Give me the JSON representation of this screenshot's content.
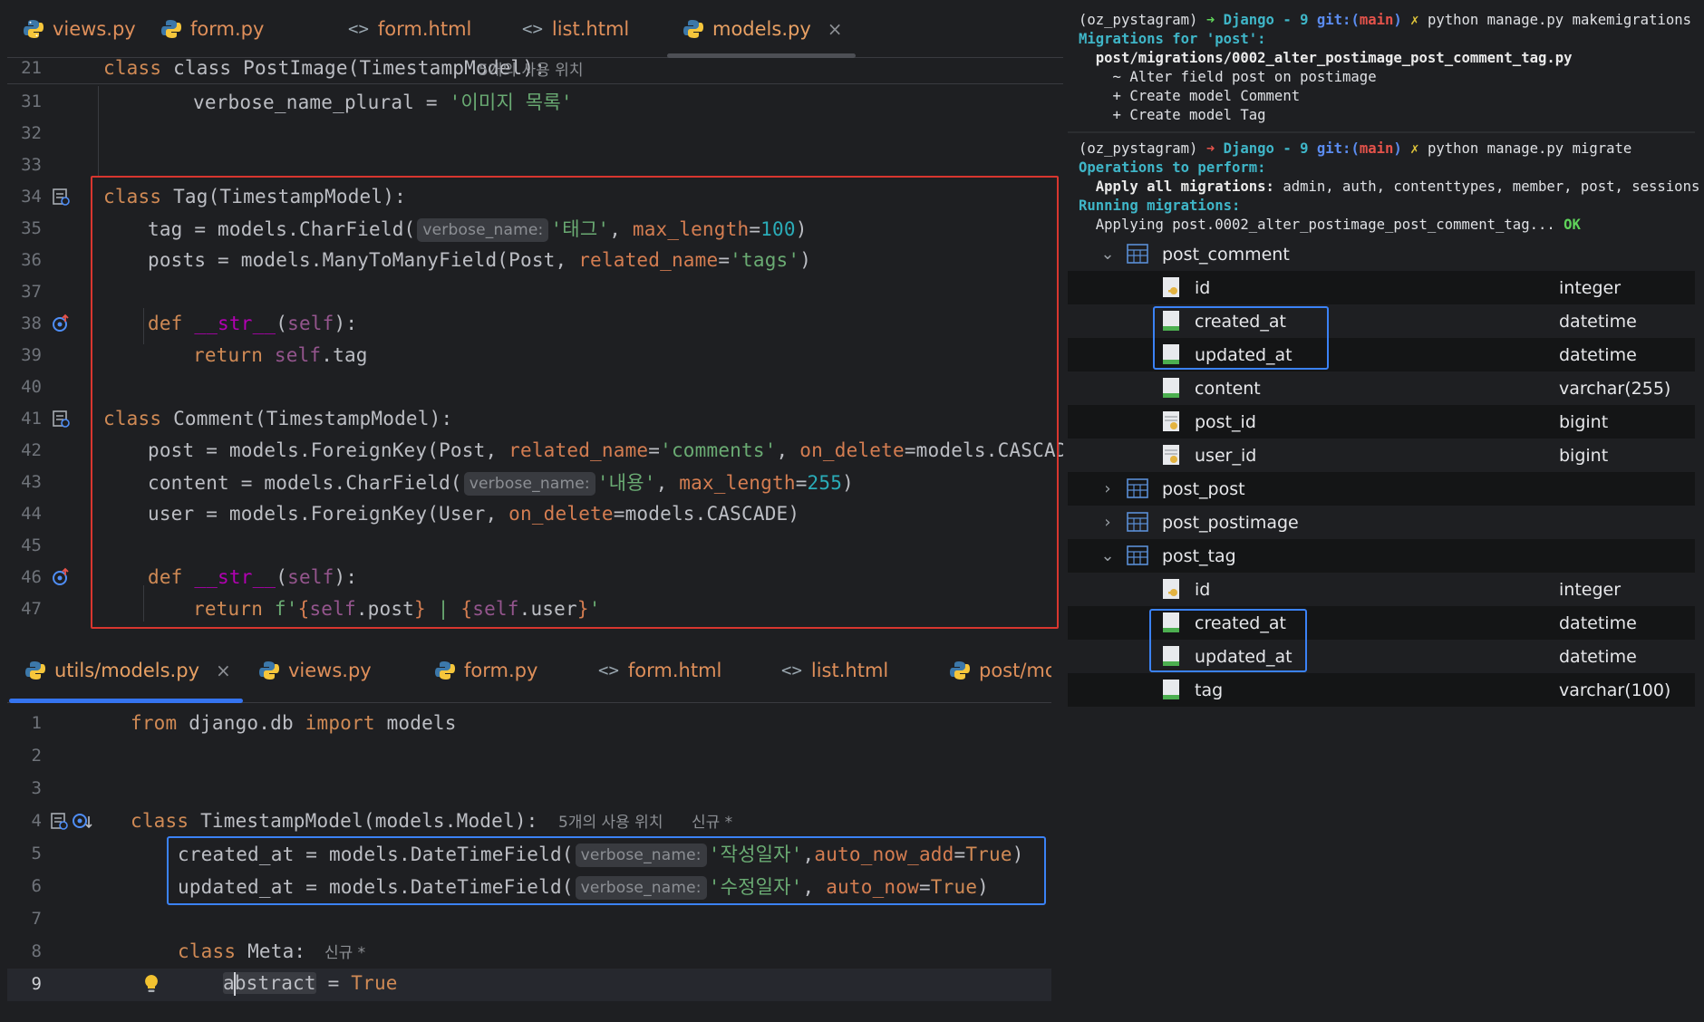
{
  "top_editor": {
    "tabs": [
      {
        "label": "views.py",
        "kind": "python",
        "active": false
      },
      {
        "label": "form.py",
        "kind": "python",
        "active": false
      },
      {
        "label": "form.html",
        "kind": "html",
        "active": false
      },
      {
        "label": "list.html",
        "kind": "html",
        "active": false
      },
      {
        "label": "models.py",
        "kind": "python",
        "active": true,
        "close": "×"
      }
    ],
    "sticky_line_no": "21",
    "sticky_code": "class PostImage(TimestampModel):",
    "sticky_usages": "5개의 사용 위치",
    "line_numbers": [
      "31",
      "32",
      "33",
      "34",
      "35",
      "36",
      "37",
      "38",
      "39",
      "40",
      "41",
      "42",
      "43",
      "44",
      "45",
      "46",
      "47"
    ],
    "code": {
      "l31_a": "verbose_name_plural = ",
      "l31_s": "'이미지 목록'",
      "l34_kw": "class ",
      "l34_rest": "Tag(TimestampModel):",
      "l35_a": "tag = models.CharField(",
      "l35_hint": "verbose_name:",
      "l35_s": "'태그'",
      "l35_b": ", ",
      "l35_k": "max_length",
      "l35_eq": "=",
      "l35_n": "100",
      "l35_c": ")",
      "l36_a": "posts = models.ManyToManyField(Post, ",
      "l36_k": "related_name",
      "l36_eq": "=",
      "l36_s": "'tags'",
      "l36_c": ")",
      "l38_kw": "def ",
      "l38_fn": "__str__",
      "l38_p": "(",
      "l38_self": "self",
      "l38_c": "):",
      "l39_kw": "return ",
      "l39_self": "self",
      "l39_rest": ".tag",
      "l41_kw": "class ",
      "l41_rest": "Comment(TimestampModel):",
      "l42_a": "post = models.ForeignKey(Post, ",
      "l42_k1": "related_name",
      "l42_eq1": "=",
      "l42_s": "'comments'",
      "l42_b": ", ",
      "l42_k2": "on_delete",
      "l42_rest": "=models.CASCADE)",
      "l43_a": "content = models.CharField(",
      "l43_hint": "verbose_name:",
      "l43_s": "'내용'",
      "l43_b": ", ",
      "l43_k": "max_length",
      "l43_eq": "=",
      "l43_n": "255",
      "l43_c": ")",
      "l44_a": "user = models.ForeignKey(User, ",
      "l44_k": "on_delete",
      "l44_rest": "=models.CASCADE)",
      "l46_kw": "def ",
      "l46_fn": "__str__",
      "l46_p": "(",
      "l46_self": "self",
      "l46_c": "):",
      "l47_kw": "return ",
      "l47_f": "f'",
      "l47_b1": "{",
      "l47_self1": "self",
      "l47_r1": ".post",
      "l47_b2": "}",
      "l47_mid": " | ",
      "l47_b3": "{",
      "l47_self2": "self",
      "l47_r2": ".user",
      "l47_b4": "}",
      "l47_end": "'"
    }
  },
  "bottom_editor": {
    "tabs": [
      {
        "label": "utils/models.py",
        "kind": "python",
        "active": true,
        "close": "×"
      },
      {
        "label": "views.py",
        "kind": "python",
        "active": false
      },
      {
        "label": "form.py",
        "kind": "python",
        "active": false
      },
      {
        "label": "form.html",
        "kind": "html",
        "active": false
      },
      {
        "label": "list.html",
        "kind": "html",
        "active": false
      },
      {
        "label": "post/mc",
        "kind": "python",
        "active": false
      }
    ],
    "line_numbers": [
      "1",
      "2",
      "3",
      "4",
      "5",
      "6",
      "7",
      "8",
      "9"
    ],
    "code": {
      "l1_kw1": "from ",
      "l1_mod": "django.db ",
      "l1_kw2": "import ",
      "l1_rest": "models",
      "l4_kw": "class ",
      "l4_rest": "TimestampModel(models.Model):",
      "l4_usages": "5개의 사용 위치",
      "l4_new": "신규 *",
      "l5_a": "created_at = models.DateTimeField(",
      "l5_hint": "verbose_name:",
      "l5_s": "'작성일자'",
      "l5_b": ",",
      "l5_k": "auto_now_add",
      "l5_eq": "=",
      "l5_v": "True",
      "l5_c": ")",
      "l6_a": "updated_at = models.DateTimeField(",
      "l6_hint": "verbose_name:",
      "l6_s": "'수정일자'",
      "l6_b": ", ",
      "l6_k": "auto_now",
      "l6_eq": "=",
      "l6_v": "True",
      "l6_c": ")",
      "l8_kw": "class ",
      "l8_rest": "Meta:",
      "l8_new": "신규 *",
      "l9_a": "a",
      "l9_b": "bstract",
      "l9_eq": " = ",
      "l9_v": "True"
    }
  },
  "terminal": {
    "c1_env": "(oz_pystagram) ",
    "c1_arrow": "➜ ",
    "c1_dir": "Django - 9 ",
    "c1_git": "git:(",
    "c1_branch": "main",
    "c1_git2": ")",
    "c1_x": " ✗ ",
    "c1_cmd": "python manage.py makemigrations",
    "o1": "Migrations for 'post':",
    "o2": "  post/migrations/0002_alter_postimage_post_comment_tag.py",
    "o3": "    ~ Alter field post on postimage",
    "o4": "    + Create model Comment",
    "o5": "    + Create model Tag",
    "c2_env": "(oz_pystagram) ",
    "c2_arrow": "➜ ",
    "c2_dir": "Django - 9 ",
    "c2_git": "git:(",
    "c2_branch": "main",
    "c2_git2": ")",
    "c2_x": " ✗ ",
    "c2_cmd": "python manage.py migrate",
    "o6": "Operations to perform:",
    "o7_a": "  Apply all migrations: ",
    "o7_b": "admin, auth, contenttypes, member, post, sessions",
    "o8": "Running migrations:",
    "o9_a": "  Applying post.0002_alter_postimage_post_comment_tag... ",
    "o9_b": "OK"
  },
  "db_tree": {
    "post_comment": {
      "name": "post_comment",
      "expanded": true,
      "columns": [
        {
          "name": "id",
          "type": "integer",
          "icon": "key-column-icon"
        },
        {
          "name": "created_at",
          "type": "datetime",
          "icon": "column-icon"
        },
        {
          "name": "updated_at",
          "type": "datetime",
          "icon": "column-icon"
        },
        {
          "name": "content",
          "type": "varchar(255)",
          "icon": "column-icon"
        },
        {
          "name": "post_id",
          "type": "bigint",
          "icon": "foreign-key-column-icon"
        },
        {
          "name": "user_id",
          "type": "bigint",
          "icon": "foreign-key-column-icon"
        }
      ]
    },
    "post_post": {
      "name": "post_post",
      "expanded": false
    },
    "post_postimage": {
      "name": "post_postimage",
      "expanded": false
    },
    "post_tag": {
      "name": "post_tag",
      "expanded": true,
      "columns": [
        {
          "name": "id",
          "type": "integer",
          "icon": "key-column-icon"
        },
        {
          "name": "created_at",
          "type": "datetime",
          "icon": "column-icon"
        },
        {
          "name": "updated_at",
          "type": "datetime",
          "icon": "column-icon"
        },
        {
          "name": "tag",
          "type": "varchar(100)",
          "icon": "column-icon"
        }
      ]
    }
  },
  "colors": {
    "highlight_red": "#d8362f",
    "highlight_blue": "#3b82f6",
    "accent_tab": "#3574f0"
  }
}
